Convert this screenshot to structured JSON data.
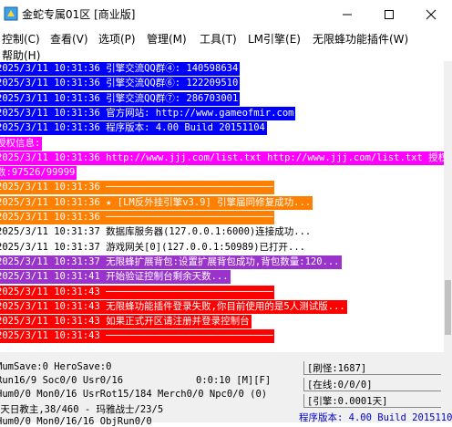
{
  "window": {
    "title": "金蛇专属01区 [商业版]",
    "minimize_glyph": "—",
    "maximize_glyph": "☐",
    "close_glyph": "✕"
  },
  "menu": {
    "items": [
      "控制(C)",
      "查看(V)",
      "选项(P)",
      "管理(M)",
      "工具(T)",
      "LM引擎(E)",
      "无限蜂功能插件(W)",
      "帮助(H)"
    ]
  },
  "log": {
    "lines": [
      {
        "text": "2025/3/11 10:31:36 引擎交流QQ群④: 140598634",
        "bg": "#0000ff",
        "fg": "#ffffff"
      },
      {
        "text": "2025/3/11 10:31:36 引擎交流QQ群⑥: 122209510",
        "bg": "#0000ff",
        "fg": "#ffffff"
      },
      {
        "text": "2025/3/11 10:31:36 引擎交流QQ群⑦: 286703001",
        "bg": "#0000ff",
        "fg": "#ffffff"
      },
      {
        "text": "2025/3/11 10:31:36 官方网站: http://www.gameofmir.com",
        "bg": "#0000ff",
        "fg": "#ffffff"
      },
      {
        "text": "2025/3/11 10:31:36 程序版本: 4.00 Build 20151104",
        "bg": "#0000ff",
        "fg": "#ffffff"
      },
      {
        "text": "授权信息:",
        "bg": "#ff00ff",
        "fg": "#ffffff"
      },
      {
        "text": "2025/3/11 10:31:36 http://www.jjj.com/list.txt http://www.jjj.com/list.txt 授权天",
        "bg": "#ff00ff",
        "fg": "#ffffff"
      },
      {
        "text": "数:97526/99999",
        "bg": "#ff00ff",
        "fg": "#ffffff"
      },
      {
        "text": "2025/3/11 10:31:36 ─────────────────────────────",
        "bg": "#ff7f00",
        "fg": "#ffffff"
      },
      {
        "text": "2025/3/11 10:31:36 ★ [LM反外挂引擎v3.9] 引擎届同修复成功...",
        "bg": "#ff7f00",
        "fg": "#ffffff"
      },
      {
        "text": "2025/3/11 10:31:36 ─────────────────────────────",
        "bg": "#ff7f00",
        "fg": "#ffffff"
      },
      {
        "text": "2025/3/11 10:31:37 数据库服务器(127.0.0.1:6000)连接成功...",
        "bg": "#ffffff",
        "fg": "#000000"
      },
      {
        "text": "2025/3/11 10:31:37 游戏网关[0](127.0.0.1:50989)已打开...",
        "bg": "#ffffff",
        "fg": "#000000"
      },
      {
        "text": "2025/3/11 10:31:37 无限蜂扩展背包:设置扩展背包成功,背包数量:120...",
        "bg": "#9933cc",
        "fg": "#ffffff"
      },
      {
        "text": "2025/3/11 10:31:41 开始验证控制台剩余天数...",
        "bg": "#9933cc",
        "fg": "#ffffff"
      },
      {
        "text": "2025/3/11 10:31:43 ─────────────────────────────",
        "bg": "#ff0000",
        "fg": "#ffffff"
      },
      {
        "text": "2025/3/11 10:31:43 无限蜂功能插件登录失败,你目前使用的是5人测试版...",
        "bg": "#ff0000",
        "fg": "#ffffff"
      },
      {
        "text": "2025/3/11 10:31:43 如果正式开区请注册并登录控制台",
        "bg": "#ff0000",
        "fg": "#ffffff"
      },
      {
        "text": "2025/3/11 10:31:43 ─────────────────────────────",
        "bg": "#ff0000",
        "fg": "#ffffff"
      }
    ]
  },
  "status": {
    "line1": "MumSave:0 HeroSave:0",
    "line2": "Run16/9 Soc0/0 Usr0/16",
    "line2b": "0:0:10 [M][F]",
    "line3": "Hum0/0 Mon0/16 UsrRot15/184 Merch0/0 Npc0/0 (0)",
    "line4": "[天日教主,38/460 - 玛雅战士/23/5",
    "line5": "Hum0/0 Mon0/16/16 ObjRun0/0",
    "refresh": "[刷怪:1687]",
    "online": "[在线:0/0/0]",
    "engine": "[引擎:0.0001天]",
    "version": "程序版本: 4.00 Build 2015110"
  }
}
